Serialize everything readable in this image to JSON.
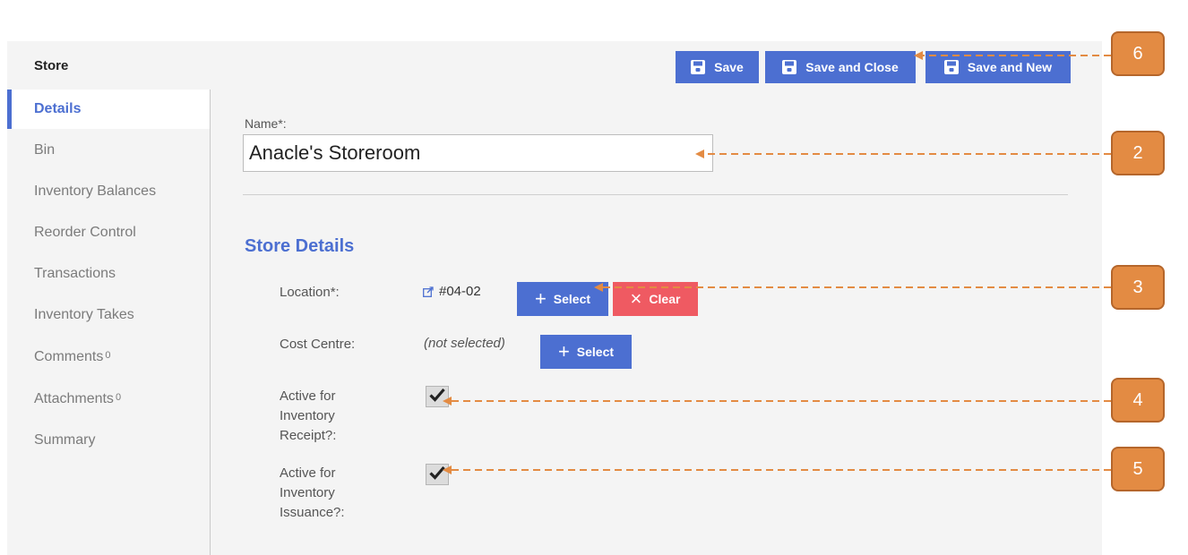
{
  "header": {
    "title": "Store"
  },
  "toolbar": {
    "save_label": "Save",
    "save_close_label": "Save and Close",
    "save_new_label": "Save and New"
  },
  "sidebar": {
    "items": [
      {
        "label": "Details",
        "active": true
      },
      {
        "label": "Bin"
      },
      {
        "label": "Inventory Balances"
      },
      {
        "label": "Reorder Control"
      },
      {
        "label": "Transactions"
      },
      {
        "label": "Inventory Takes"
      },
      {
        "label": "Comments",
        "count": "0"
      },
      {
        "label": "Attachments",
        "count": "0"
      },
      {
        "label": "Summary"
      }
    ]
  },
  "form": {
    "name_label": "Name*:",
    "name_value": "Anacle's Storeroom",
    "section_title": "Store Details",
    "location_label": "Location*:",
    "location_value": "#04-02",
    "select_label": "Select",
    "clear_label": "Clear",
    "cost_centre_label": "Cost Centre:",
    "cost_centre_value": "(not selected)",
    "receipt_label_lines": [
      "Active for",
      "Inventory",
      "Receipt?:"
    ],
    "receipt_checked": true,
    "issuance_label_lines": [
      "Active for",
      "Inventory",
      "Issuance?:"
    ],
    "issuance_checked": true
  },
  "annotations": [
    {
      "number": "6"
    },
    {
      "number": "2"
    },
    {
      "number": "3"
    },
    {
      "number": "4"
    },
    {
      "number": "5"
    }
  ],
  "colors": {
    "accent": "#4c6fd1",
    "danger": "#ef5a62",
    "annotation": "#e38b43",
    "background": "#f4f4f4"
  },
  "icons": {
    "save": "floppy-disk-icon",
    "external_link": "external-link-icon",
    "plus": "plus-icon",
    "close": "close-icon",
    "check": "checkmark-icon"
  }
}
